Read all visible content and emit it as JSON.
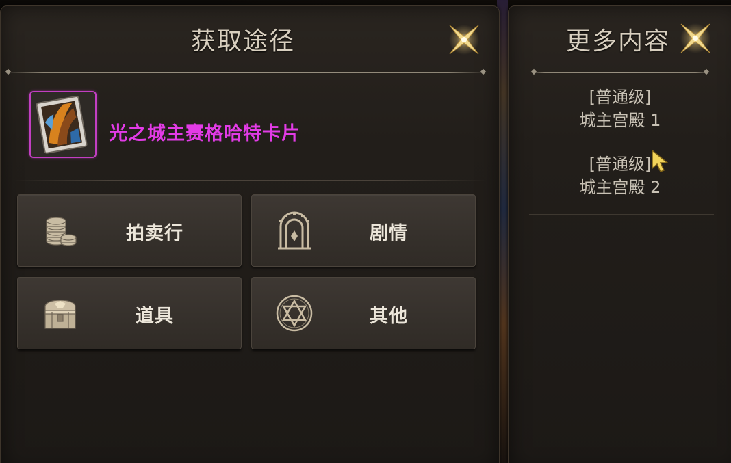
{
  "left_panel": {
    "title": "获取途径",
    "close_icon": "close-x-star-icon",
    "item": {
      "icon": "card-icon",
      "name": "光之城主赛格哈特卡片",
      "name_color": "#e23be6",
      "frame_color": "#c23fc2"
    },
    "sources": [
      {
        "label": "拍卖行",
        "icon": "coins-stack-icon"
      },
      {
        "label": "剧情",
        "icon": "arch-gate-icon"
      },
      {
        "label": "道具",
        "icon": "treasure-chest-icon"
      },
      {
        "label": "其他",
        "icon": "hexagram-icon"
      }
    ]
  },
  "right_panel": {
    "title": "更多内容",
    "close_icon": "close-x-star-icon",
    "entries": [
      {
        "difficulty": "[普通级]",
        "dungeon": "城主宫殿 1"
      },
      {
        "difficulty": "[普通级]",
        "dungeon": "城主宫殿 2"
      }
    ]
  },
  "colors": {
    "panel_bg": "#221e1a",
    "title_text": "#d8cfbf",
    "button_text": "#ece6da",
    "accent_gold": "#e9c97a"
  }
}
